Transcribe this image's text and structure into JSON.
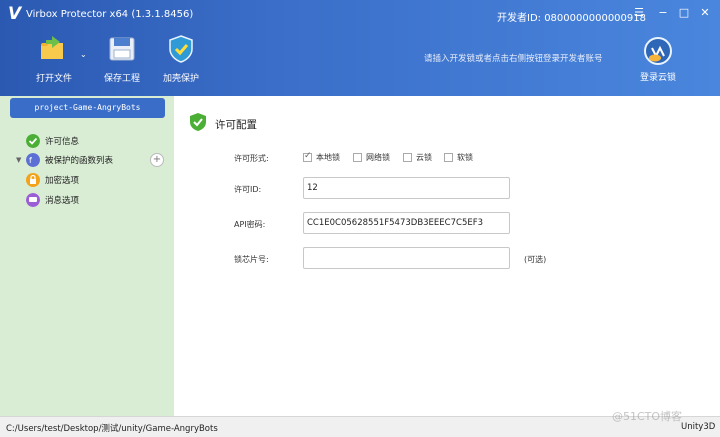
{
  "window": {
    "logo_letter": "V",
    "title": "Virbox Protector x64  (1.3.1.8456)",
    "developer_id": "开发者ID:  0800000000000918",
    "controls": [
      "☰",
      "−",
      "□",
      "✕"
    ]
  },
  "toolbar": {
    "open_file": "打开文件",
    "save_project": "保存工程",
    "protect": "加壳保护",
    "hint": "请插入开发锁或者点击右侧按钮登录开发者账号",
    "cloud_login": "登录云锁"
  },
  "sidebar": {
    "project_name": "project-Game-AngryBots",
    "items": [
      {
        "label": "许可信息",
        "icon": "check-shield-icon"
      },
      {
        "label": "被保护的函数列表",
        "icon": "function-icon"
      },
      {
        "label": "加密选项",
        "icon": "lock-icon"
      },
      {
        "label": "消息选项",
        "icon": "message-icon"
      }
    ]
  },
  "content": {
    "section_title": "许可配置",
    "license_form_label": "许可形式:",
    "license_options": [
      {
        "label": "本地锁",
        "checked": true
      },
      {
        "label": "网络锁",
        "checked": false
      },
      {
        "label": "云锁",
        "checked": false
      },
      {
        "label": "软锁",
        "checked": false
      }
    ],
    "license_id_label": "许可ID:",
    "license_id_value": "12",
    "api_key_label": "API密码:",
    "api_key_value": "CC1E0C05628551F5473DB3EEEC7C5EF3",
    "chip_label": "锁芯片号:",
    "chip_value": "",
    "optional_note": "(可选)"
  },
  "statusbar": {
    "path": "C:/Users/test/Desktop/测试/unity/Game-AngryBots",
    "engine": "Unity3D"
  },
  "watermark": "@51CTO博客",
  "colors": {
    "header": "#3b6fc9",
    "sidebar": "#d9ecd4",
    "project_tag": "#3a6dc8",
    "check_green": "#4caf35"
  }
}
